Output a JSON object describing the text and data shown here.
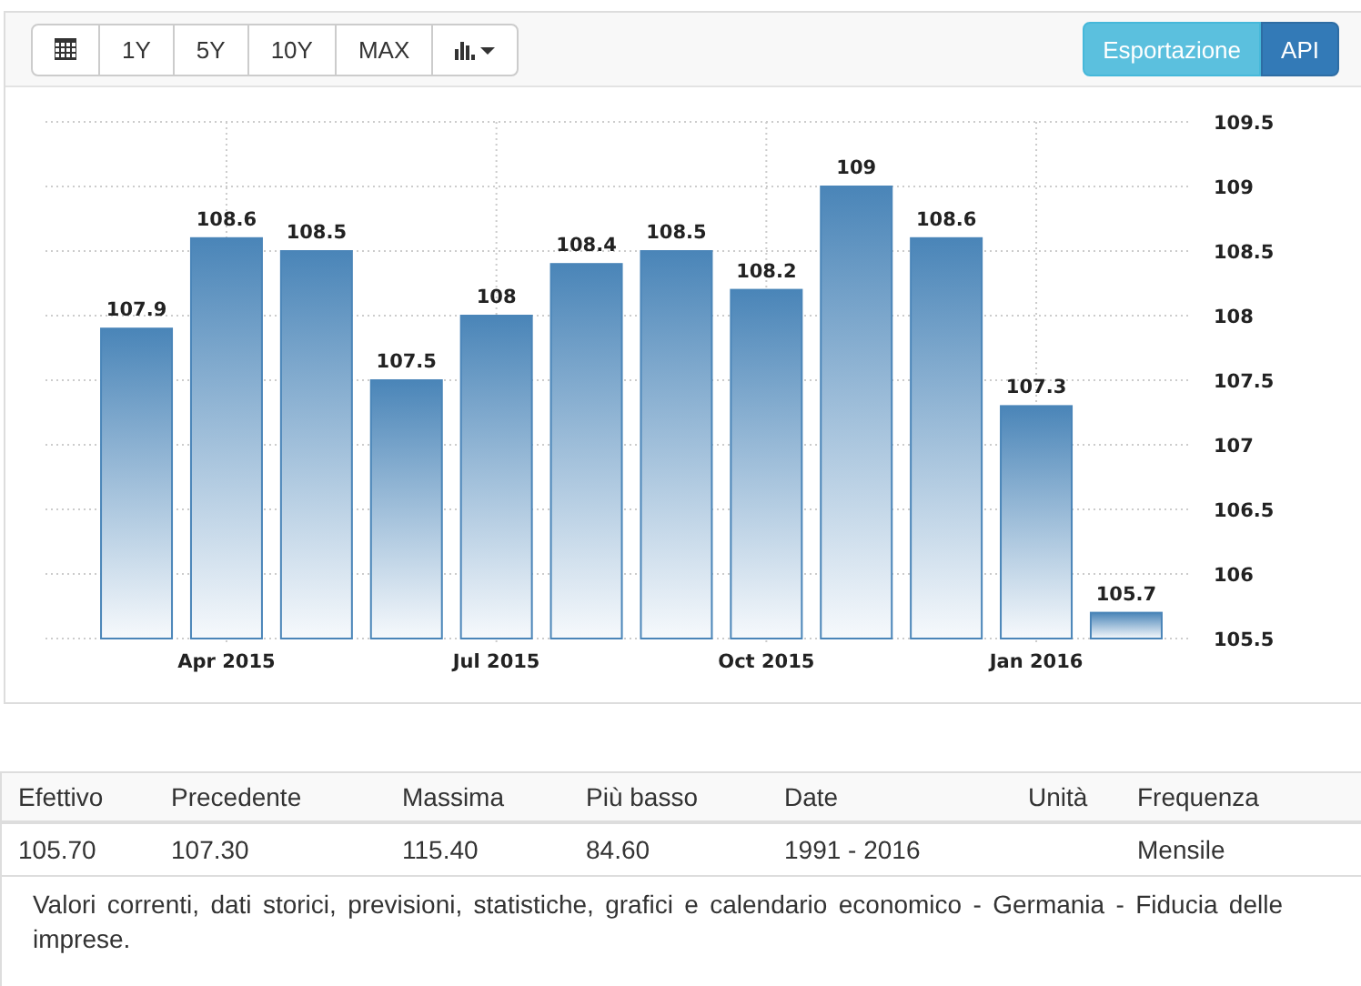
{
  "toolbar": {
    "buttons": [
      {
        "kind": "calendar"
      },
      {
        "kind": "text",
        "label": "1Y"
      },
      {
        "kind": "text",
        "label": "5Y"
      },
      {
        "kind": "text",
        "label": "10Y"
      },
      {
        "kind": "text",
        "label": "MAX"
      },
      {
        "kind": "chart-menu"
      }
    ],
    "actions": [
      {
        "kind": "info",
        "label": "Esportazione"
      },
      {
        "kind": "primary",
        "label": "API"
      }
    ]
  },
  "chart": {
    "chart_data": {
      "type": "bar",
      "categories": [
        null,
        "Apr 2015",
        null,
        null,
        "Jul 2015",
        null,
        null,
        "Oct 2015",
        null,
        null,
        "Jan 2016",
        null
      ],
      "grid": true,
      "series": [
        {
          "color": "#4a85b8",
          "values": [
            107.9,
            108.6,
            108.5,
            107.5,
            108,
            108.4,
            108.5,
            108.2,
            109,
            108.6,
            107.3,
            105.7
          ]
        }
      ],
      "value_labels": [
        "107.9",
        "108.6",
        "108.5",
        "107.5",
        "108",
        "108.4",
        "108.5",
        "108.2",
        "109",
        "108.6",
        "107.3",
        "105.7"
      ],
      "ylim": [
        105.5,
        109.5
      ],
      "yticks": [
        105.5,
        106,
        106.5,
        107,
        107.5,
        108,
        108.5,
        109,
        109.5
      ]
    }
  },
  "table": {
    "columns": [
      "Efettivo",
      "Precedente",
      "Massima",
      "Più basso",
      "Date",
      "Unità",
      "Frequenza"
    ],
    "rows": [
      [
        "105.70",
        "107.30",
        "115.40",
        "84.60",
        "1991 - 2016",
        "",
        "Mensile"
      ]
    ],
    "description": "Valori correnti, dati storici, previsioni, statistiche, grafici e calendario economico - Germania - Fiducia delle imprese."
  }
}
